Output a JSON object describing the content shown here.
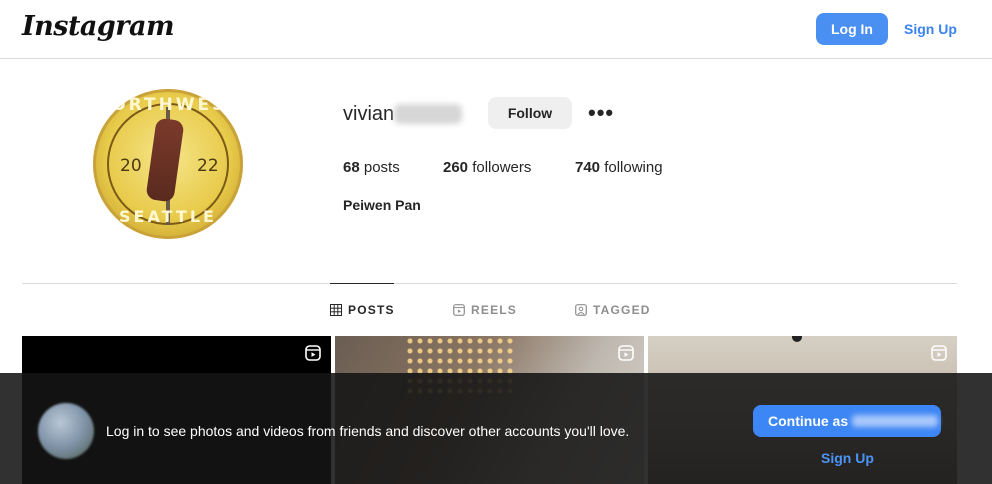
{
  "header": {
    "logo_text": "Instagram",
    "login_label": "Log In",
    "signup_label": "Sign Up"
  },
  "profile": {
    "avatar_text": {
      "top": "NORTHWEST",
      "bottom": "SEATTLE",
      "year_left": "20",
      "year_right": "22"
    },
    "username_visible": "vivian",
    "follow_label": "Follow",
    "more_icon": "ellipsis-icon",
    "stats": {
      "posts_count": "68",
      "posts_label": " posts",
      "followers_count": "260",
      "followers_label": " followers",
      "following_count": "740",
      "following_label": " following"
    },
    "full_name": "Peiwen Pan"
  },
  "tabs": [
    {
      "label": "POSTS",
      "icon": "grid-icon",
      "active": true
    },
    {
      "label": "REELS",
      "icon": "reels-icon",
      "active": false
    },
    {
      "label": "TAGGED",
      "icon": "tagged-icon",
      "active": false
    }
  ],
  "grid": {
    "tile_icon": "reel-icon"
  },
  "login_prompt": {
    "message": "Log in to see photos and videos from friends and discover other accounts you'll love.",
    "continue_label": "Continue as",
    "signup_label": "Sign Up"
  },
  "colors": {
    "primary_blue": "#4a8ff2",
    "link_blue": "#3a83f2",
    "border": "#dbdbdb",
    "overlay": "#141414"
  }
}
